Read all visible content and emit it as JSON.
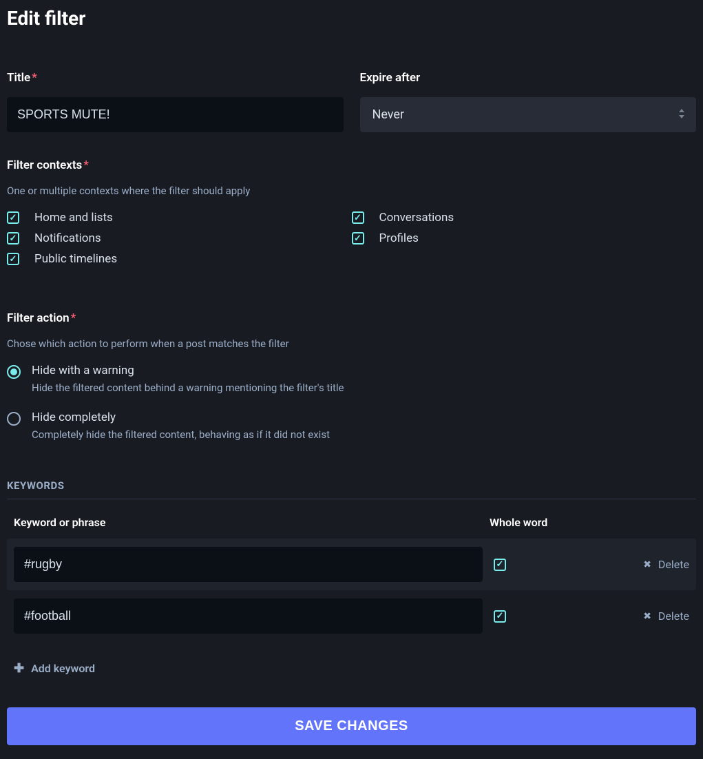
{
  "page_title": "Edit filter",
  "title_field": {
    "label": "Title",
    "required": true,
    "value": "SPORTS MUTE!"
  },
  "expire_field": {
    "label": "Expire after",
    "value": "Never"
  },
  "contexts": {
    "label": "Filter contexts",
    "required": true,
    "hint": "One or multiple contexts where the filter should apply",
    "col1": [
      {
        "label": "Home and lists",
        "checked": true
      },
      {
        "label": "Notifications",
        "checked": true
      },
      {
        "label": "Public timelines",
        "checked": true
      }
    ],
    "col2": [
      {
        "label": "Conversations",
        "checked": true
      },
      {
        "label": "Profiles",
        "checked": true
      }
    ]
  },
  "action": {
    "label": "Filter action",
    "required": true,
    "hint": "Chose which action to perform when a post matches the filter",
    "options": [
      {
        "title": "Hide with a warning",
        "desc": "Hide the filtered content behind a warning mentioning the filter's title",
        "selected": true
      },
      {
        "title": "Hide completely",
        "desc": "Completely hide the filtered content, behaving as if it did not exist",
        "selected": false
      }
    ]
  },
  "keywords": {
    "header": "KEYWORDS",
    "col_keyword": "Keyword or phrase",
    "col_whole": "Whole word",
    "rows": [
      {
        "value": "#rugby",
        "whole": true
      },
      {
        "value": "#football",
        "whole": true
      }
    ],
    "delete_label": "Delete",
    "add_label": "Add keyword"
  },
  "save_label": "SAVE CHANGES"
}
